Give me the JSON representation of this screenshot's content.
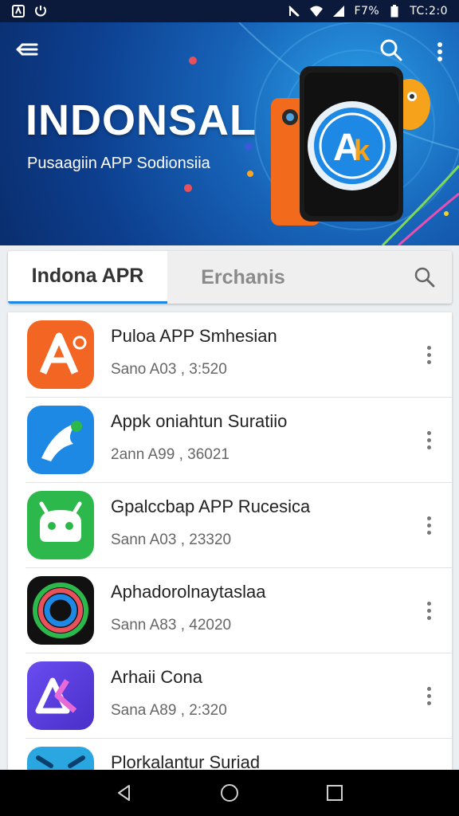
{
  "status_bar": {
    "left_icons": [
      "notification-icon",
      "sync-icon"
    ],
    "right_icons": [
      "no-signal-icon",
      "wifi-icon",
      "signal-icon",
      "battery-icon"
    ],
    "battery_text": "F7%",
    "time": "TC:2:0"
  },
  "banner": {
    "title": "INDONSAL",
    "subtitle": "Pusaagiin APP Sodionsiia",
    "logo_text": "A",
    "logo_accent": "k"
  },
  "tabs": [
    {
      "label": "Indona APR",
      "active": true
    },
    {
      "label": "Erchanis",
      "active": false
    }
  ],
  "apps": [
    {
      "name": "Puloa APP Smhesian",
      "meta": "Sano A03 , 3:520",
      "icon": "orange-a-app-icon",
      "color": "#f26522"
    },
    {
      "name": "Appk oniahtun Suratiio",
      "meta": "2ann A99 , 36021",
      "icon": "blue-swirl-app-icon",
      "color": "#1e88e5"
    },
    {
      "name": "Gpalccbap APP Rucesica",
      "meta": "Sann A03 , 23320",
      "icon": "green-android-app-icon",
      "color": "#2db84b"
    },
    {
      "name": "Aphadorolnaytaslaa",
      "meta": "Sann A83 , 42020",
      "icon": "black-rings-app-icon",
      "color": "#111111"
    },
    {
      "name": "Arhaii Cona",
      "meta": "Sana A89 , 2:320",
      "icon": "purple-ak-app-icon",
      "color": "#5b3ee0"
    },
    {
      "name": "Plorkalantur Suriad",
      "meta": "",
      "icon": "teal-app-icon",
      "color": "#2aa7e0"
    }
  ],
  "colors": {
    "accent": "#1e88e5",
    "banner_dark": "#0a2e6e",
    "banner_light": "#2aa0e8"
  }
}
